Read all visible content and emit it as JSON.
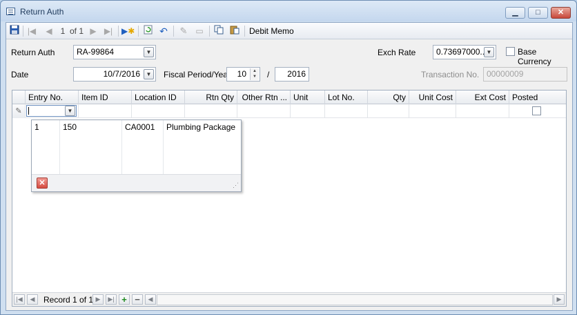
{
  "window": {
    "title": "Return Auth",
    "min_label": "▁",
    "max_label": "□",
    "close_label": "✕"
  },
  "toolbar": {
    "record_position": "1",
    "record_of": "of 1",
    "debit_memo_label": "Debit Memo"
  },
  "form": {
    "return_auth_label": "Return Auth",
    "return_auth_value": "RA-99864",
    "date_label": "Date",
    "date_value": "10/7/2016",
    "fiscal_label": "Fiscal Period/Year",
    "period_value": "10",
    "slash": "/",
    "year_value": "2016",
    "exch_rate_label": "Exch Rate",
    "exch_rate_value": "0.73697000...",
    "base_currency_label": "Base Currency",
    "transaction_no_label": "Transaction No.",
    "transaction_no_value": "00000009"
  },
  "grid": {
    "columns": [
      "Entry No.",
      "Item ID",
      "Location ID",
      "Rtn Qty",
      "Other Rtn ...",
      "Unit",
      "Lot No.",
      "Qty",
      "Unit Cost",
      "Ext Cost",
      "Posted"
    ],
    "new_row_indicator": "✎"
  },
  "dropdown_popup": {
    "rows": [
      {
        "col1": "1",
        "col2": "150",
        "col3": "CA0001",
        "col4": "Plumbing Package"
      }
    ],
    "close_label": "✕",
    "grip": "⋰"
  },
  "navigator": {
    "record_text": "Record 1 of 1",
    "add_label": "+",
    "remove_label": "−"
  },
  "colors": {
    "title_bg": "#c4d7ee",
    "client_bg": "#f0f0f0",
    "add_button": "#1e8a1e",
    "close_button": "#d54b40"
  }
}
